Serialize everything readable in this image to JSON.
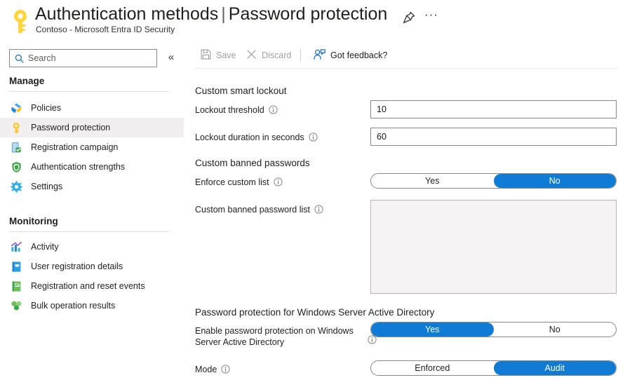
{
  "header": {
    "icon": "key-icon",
    "title_main": "Authentication methods",
    "title_separator": "|",
    "title_sub": "Password protection",
    "subtitle": "Contoso - Microsoft Entra ID Security",
    "pin_icon": "pin-icon",
    "more_icon": "ellipsis-icon",
    "more_label": "···"
  },
  "sidebar": {
    "search": {
      "placeholder": "Search",
      "value": "",
      "icon": "search-icon"
    },
    "collapse_icon": "chevron-double-left-icon",
    "collapse_label": "«",
    "groups": [
      {
        "label": "Manage",
        "items": [
          {
            "label": "Policies",
            "icon": "policies-icon",
            "selected": false
          },
          {
            "label": "Password protection",
            "icon": "key-icon",
            "selected": true
          },
          {
            "label": "Registration campaign",
            "icon": "registration-campaign-icon",
            "selected": false
          },
          {
            "label": "Authentication strengths",
            "icon": "shield-icon",
            "selected": false
          },
          {
            "label": "Settings",
            "icon": "gear-icon",
            "selected": false
          }
        ]
      },
      {
        "label": "Monitoring",
        "items": [
          {
            "label": "Activity",
            "icon": "activity-chart-icon",
            "selected": false
          },
          {
            "label": "User registration details",
            "icon": "user-registration-book-icon",
            "selected": false
          },
          {
            "label": "Registration and reset events",
            "icon": "registration-events-book-icon",
            "selected": false
          },
          {
            "label": "Bulk operation results",
            "icon": "bulk-operations-icon",
            "selected": false
          }
        ]
      }
    ]
  },
  "commandbar": {
    "save": {
      "label": "Save",
      "icon": "save-disk-icon",
      "enabled": false
    },
    "discard": {
      "label": "Discard",
      "icon": "close-x-icon",
      "enabled": false
    },
    "feedback": {
      "label": "Got feedback?",
      "icon": "feedback-person-icon",
      "enabled": true
    }
  },
  "main": {
    "smart_lockout": {
      "section_title": "Custom smart lockout",
      "lockout_threshold": {
        "label": "Lockout threshold",
        "value": "10",
        "info": "info-icon"
      },
      "lockout_duration": {
        "label": "Lockout duration in seconds",
        "value": "60",
        "info": "info-icon"
      }
    },
    "banned_passwords": {
      "section_title": "Custom banned passwords",
      "enforce_custom_list": {
        "label": "Enforce custom list",
        "info": "info-icon",
        "options": [
          "Yes",
          "No"
        ],
        "selected": "No"
      },
      "custom_banned_password_list": {
        "label": "Custom banned password list",
        "info": "info-icon",
        "value": "",
        "disabled": true
      }
    },
    "windows_server_ad": {
      "section_title": "Password protection for Windows Server Active Directory",
      "enable_protection": {
        "label": "Enable password protection on Windows Server Active Directory",
        "info": "info-icon",
        "options": [
          "Yes",
          "No"
        ],
        "selected": "Yes"
      },
      "mode": {
        "label": "Mode",
        "info": "info-icon",
        "options": [
          "Enforced",
          "Audit"
        ],
        "selected": "Audit"
      }
    }
  },
  "colors": {
    "accent_blue": "#0f7bd4",
    "key_gold": "#f2c230",
    "selected_row": "#f3eff1",
    "disabled_text": "#a19f9d",
    "disabled_field_bg": "#f7f3f5"
  }
}
